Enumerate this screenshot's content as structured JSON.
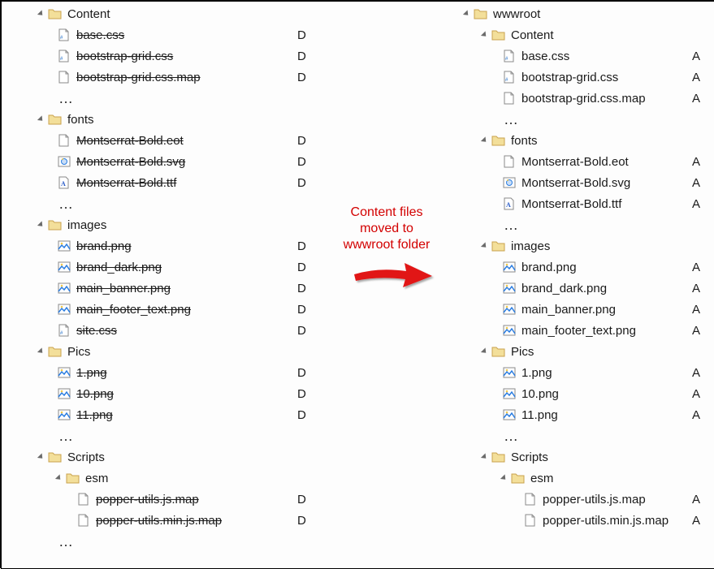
{
  "status": {
    "deleted": "D",
    "added": "A"
  },
  "anno": {
    "line1": "Content files",
    "line2": "moved to",
    "line3": "wwwroot folder"
  },
  "left": {
    "folders": [
      {
        "name": "Content",
        "level": 0,
        "items": [
          {
            "name": "base.css",
            "icon": "css",
            "deleted": true,
            "status": "D"
          },
          {
            "name": "bootstrap-grid.css",
            "icon": "css",
            "deleted": true,
            "status": "D"
          },
          {
            "name": "bootstrap-grid.css.map",
            "icon": "file",
            "deleted": true,
            "status": "D"
          }
        ],
        "ellipsis": true
      },
      {
        "name": "fonts",
        "level": 0,
        "items": [
          {
            "name": "Montserrat-Bold.eot",
            "icon": "file",
            "deleted": true,
            "status": "D"
          },
          {
            "name": "Montserrat-Bold.svg",
            "icon": "svg",
            "deleted": true,
            "status": "D"
          },
          {
            "name": "Montserrat-Bold.ttf",
            "icon": "ttf",
            "deleted": true,
            "status": "D"
          }
        ],
        "ellipsis": true
      },
      {
        "name": "images",
        "level": 0,
        "items": [
          {
            "name": "brand.png",
            "icon": "img",
            "deleted": true,
            "status": "D"
          },
          {
            "name": "brand_dark.png",
            "icon": "img",
            "deleted": true,
            "status": "D"
          },
          {
            "name": "main_banner.png",
            "icon": "img",
            "deleted": true,
            "status": "D"
          },
          {
            "name": "main_footer_text.png",
            "icon": "img",
            "deleted": true,
            "status": "D"
          },
          {
            "name": "site.css",
            "icon": "css",
            "deleted": true,
            "status": "D"
          }
        ]
      },
      {
        "name": "Pics",
        "level": 0,
        "items": [
          {
            "name": "1.png",
            "icon": "img",
            "deleted": true,
            "status": "D"
          },
          {
            "name": "10.png",
            "icon": "img",
            "deleted": true,
            "status": "D"
          },
          {
            "name": "11.png",
            "icon": "img",
            "deleted": true,
            "status": "D"
          }
        ],
        "ellipsis": true
      },
      {
        "name": "Scripts",
        "level": 0,
        "sub": {
          "name": "esm",
          "level": 1,
          "items": [
            {
              "name": "popper-utils.js.map",
              "icon": "file",
              "deleted": true,
              "status": "D"
            },
            {
              "name": "popper-utils.min.js.map",
              "icon": "file",
              "deleted": true,
              "status": "D"
            }
          ],
          "ellipsis": true
        }
      }
    ]
  },
  "right": {
    "root": {
      "name": "wwwroot",
      "level": 0,
      "folders": [
        {
          "name": "Content",
          "level": 1,
          "items": [
            {
              "name": "base.css",
              "icon": "css",
              "status": "A"
            },
            {
              "name": "bootstrap-grid.css",
              "icon": "css",
              "status": "A"
            },
            {
              "name": "bootstrap-grid.css.map",
              "icon": "file",
              "status": "A"
            }
          ],
          "ellipsis": true
        },
        {
          "name": "fonts",
          "level": 1,
          "items": [
            {
              "name": "Montserrat-Bold.eot",
              "icon": "file",
              "status": "A"
            },
            {
              "name": "Montserrat-Bold.svg",
              "icon": "svg",
              "status": "A"
            },
            {
              "name": "Montserrat-Bold.ttf",
              "icon": "ttf",
              "status": "A"
            }
          ],
          "ellipsis": true
        },
        {
          "name": "images",
          "level": 1,
          "items": [
            {
              "name": "brand.png",
              "icon": "img",
              "status": "A"
            },
            {
              "name": "brand_dark.png",
              "icon": "img",
              "status": "A"
            },
            {
              "name": "main_banner.png",
              "icon": "img",
              "status": "A"
            },
            {
              "name": "main_footer_text.png",
              "icon": "img",
              "status": "A"
            }
          ]
        },
        {
          "name": "Pics",
          "level": 1,
          "items": [
            {
              "name": "1.png",
              "icon": "img",
              "status": "A"
            },
            {
              "name": "10.png",
              "icon": "img",
              "status": "A"
            },
            {
              "name": "11.png",
              "icon": "img",
              "status": "A"
            }
          ],
          "ellipsis": true
        },
        {
          "name": "Scripts",
          "level": 1,
          "sub": {
            "name": "esm",
            "level": 2,
            "items": [
              {
                "name": "popper-utils.js.map",
                "icon": "file",
                "status": "A"
              },
              {
                "name": "popper-utils.min.js.map",
                "icon": "file",
                "status": "A"
              }
            ]
          }
        }
      ]
    }
  }
}
